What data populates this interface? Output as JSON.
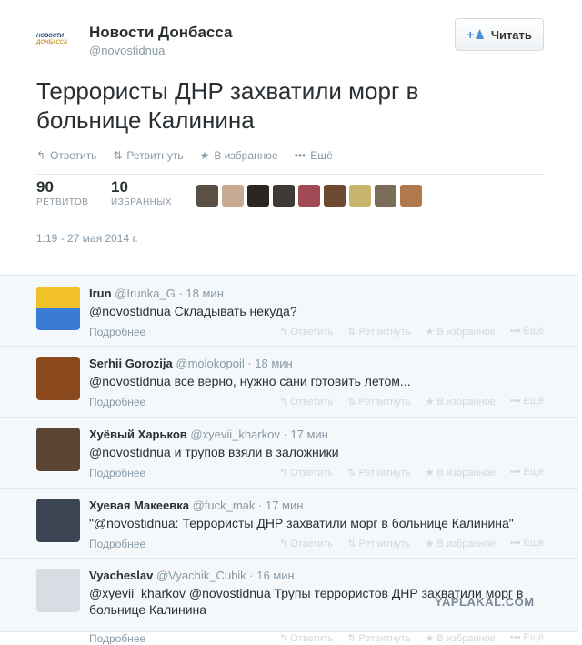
{
  "account": {
    "logo_text_1": "НОВОСТИ",
    "logo_text_2": "ДОНБАССА",
    "name": "Новости Донбасса",
    "handle": "@novostidnua",
    "follow_label": "Читать"
  },
  "tweet": {
    "text": "Террористы ДНР захватили морг в больнице Калинина",
    "actions": {
      "reply": "Ответить",
      "retweet": "Ретвитнуть",
      "favorite": "В избранное",
      "more": "Ещё"
    },
    "retweets": {
      "count": "90",
      "label": "РЕТВИТОВ"
    },
    "favorites": {
      "count": "10",
      "label": "ИЗБРАННЫХ"
    },
    "date": "1:19 - 27 мая 2014 г."
  },
  "favoriters_colors": [
    "#5a5044",
    "#c8a992",
    "#2b2520",
    "#3f3a36",
    "#a04a55",
    "#6b4a30",
    "#c8b46a",
    "#7b6e58",
    "#b0794c"
  ],
  "reply_actions": {
    "reply": "Ответить",
    "retweet": "Ретвитнуть",
    "favorite": "В избранное",
    "more": "Ещё"
  },
  "replies": [
    {
      "name": "Irun",
      "handle": "@Irunka_G",
      "time": "18 мин",
      "text": "@novostidnua Складывать некуда?",
      "more": "Подробнее"
    },
    {
      "name": "Serhii Gorozija",
      "handle": "@molokopoil",
      "time": "18 мин",
      "text": "@novostidnua все верно, нужно сани готовить летом...",
      "more": "Подробнее"
    },
    {
      "name": "Хуёвый Харьков",
      "handle": "@xyevii_kharkov",
      "time": "17 мин",
      "text": "@novostidnua и трупов взяли в заложники",
      "more": "Подробнее"
    },
    {
      "name": "Хуевая Макеевка",
      "handle": "@fuck_mak",
      "time": "17 мин",
      "text": "\"@novostidnua: Террористы ДНР захватили морг в больнице Калинина\"",
      "more": "Подробнее"
    },
    {
      "name": "Vyacheslav",
      "handle": "@Vyachik_Cubik",
      "time": "16 мин",
      "text": "@xyevii_kharkov @novostidnua Трупы террористов ДНР захватили морг в больнице Калинина",
      "more": "Подробнее"
    }
  ],
  "watermark": "YAPLAKAL.COM"
}
